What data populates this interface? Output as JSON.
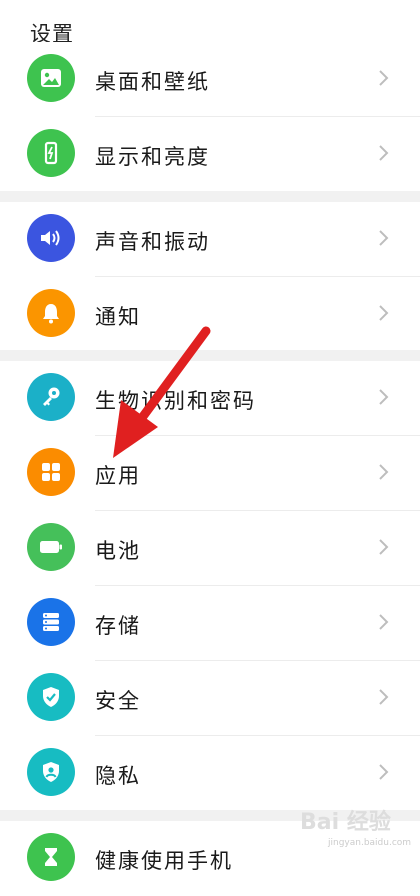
{
  "header": {
    "title": "设置"
  },
  "sections": [
    {
      "items": [
        {
          "label": "桌面和壁纸",
          "icon": "wallpaper-icon",
          "color": "#3ec34f"
        },
        {
          "label": "显示和亮度",
          "icon": "display-icon",
          "color": "#3ec34f"
        }
      ]
    },
    {
      "items": [
        {
          "label": "声音和振动",
          "icon": "sound-icon",
          "color": "#3b55e0"
        },
        {
          "label": "通知",
          "icon": "bell-icon",
          "color": "#fb9500"
        }
      ]
    },
    {
      "items": [
        {
          "label": "生物识别和密码",
          "icon": "key-icon",
          "color": "#1bb0c8"
        },
        {
          "label": "应用",
          "icon": "apps-icon",
          "color": "#fb8c00"
        },
        {
          "label": "电池",
          "icon": "battery-icon",
          "color": "#45c05a"
        },
        {
          "label": "存储",
          "icon": "storage-icon",
          "color": "#1a73e8"
        },
        {
          "label": "安全",
          "icon": "shield-check-icon",
          "color": "#17bcc2"
        },
        {
          "label": "隐私",
          "icon": "privacy-icon",
          "color": "#17bcc2"
        }
      ]
    },
    {
      "items": [
        {
          "label": "健康使用手机",
          "icon": "hourglass-icon",
          "color": "#3ec34f"
        }
      ]
    }
  ],
  "annotation": {
    "arrow_color": "#e02020"
  },
  "watermark": {
    "logo": "Bai 经验",
    "url": "jingyan.baidu.com"
  }
}
